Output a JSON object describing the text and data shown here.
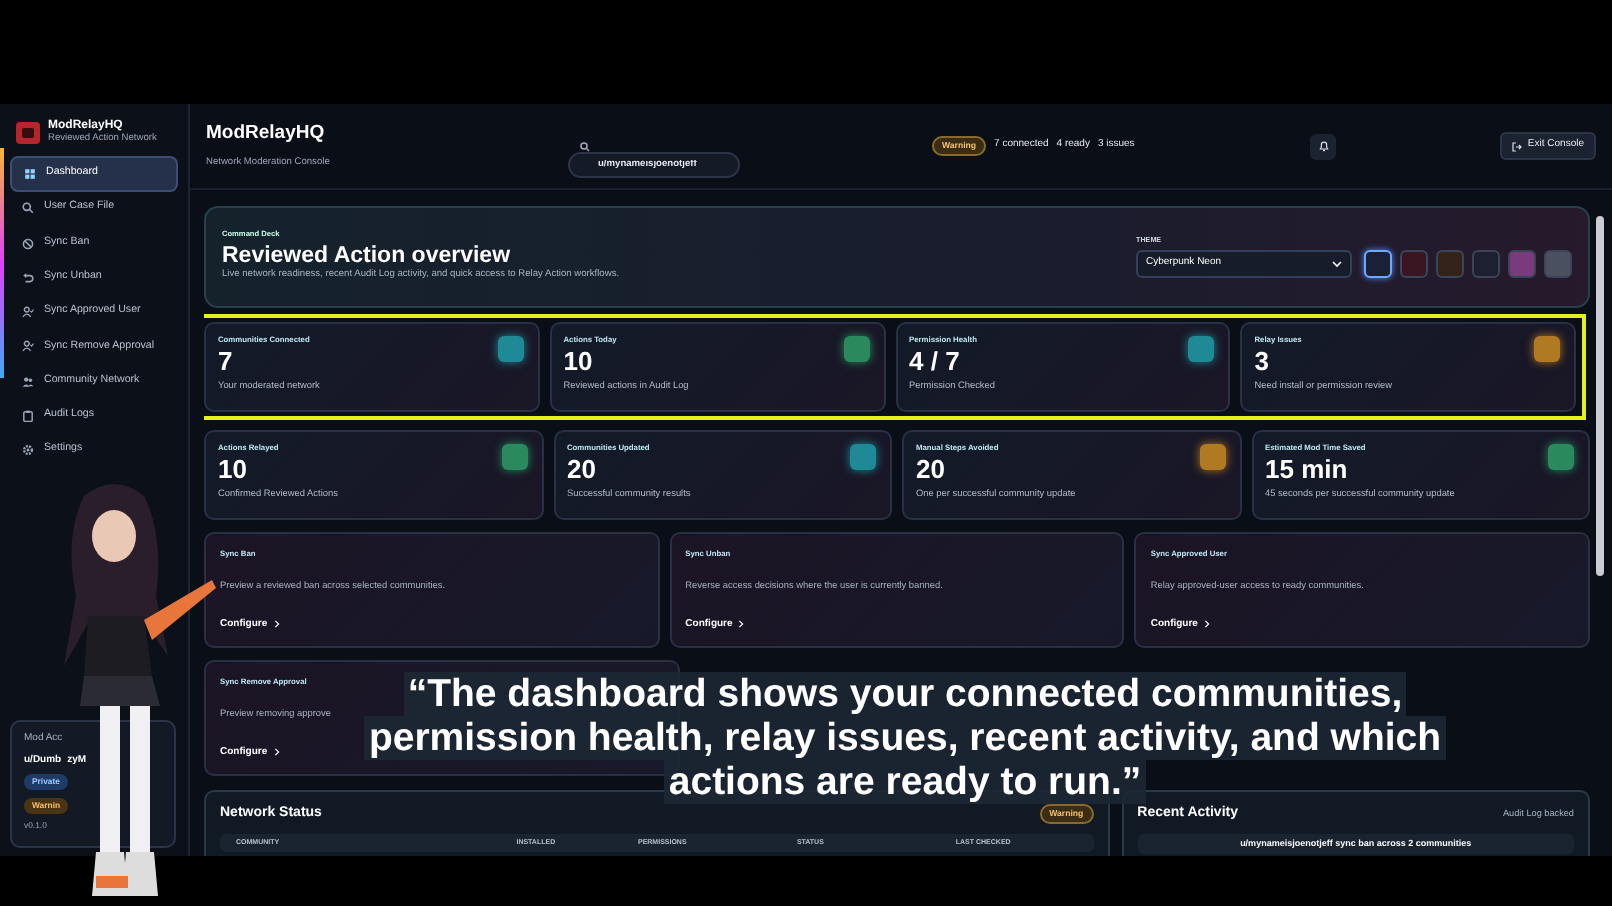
{
  "brand": {
    "name": "ModRelayHQ",
    "tagline": "Reviewed Action Network"
  },
  "sidebar": {
    "items": [
      {
        "label": "Dashboard",
        "kind": "grid",
        "selected": true
      },
      {
        "label": "User Case File",
        "kind": "search",
        "selected": false
      },
      {
        "label": "Sync Ban",
        "kind": "ban",
        "selected": false
      },
      {
        "label": "Sync Unban",
        "kind": "undo",
        "selected": false
      },
      {
        "label": "Sync Approved User",
        "kind": "user",
        "selected": false
      },
      {
        "label": "Sync Remove Approval",
        "kind": "user",
        "selected": false
      },
      {
        "label": "Community Network",
        "kind": "people",
        "selected": false
      },
      {
        "label": "Audit Logs",
        "kind": "clipboard",
        "selected": false
      },
      {
        "label": "Settings",
        "kind": "gear",
        "selected": false
      }
    ]
  },
  "account": {
    "label": "Mod Acc",
    "user": "u/Dumb",
    "user_tail": "zyM",
    "badges": [
      "Private",
      "Warnin"
    ],
    "version": "v0.1.0"
  },
  "header": {
    "title": "ModRelayHQ",
    "subtitle": "Network Moderation Console",
    "search": {
      "value": "u/mynameisjoenotjeff"
    },
    "status_badge": "Warning",
    "status_items": [
      "7 connected",
      "4 ready",
      "3 issues"
    ],
    "exit_button": "Exit Console"
  },
  "hero": {
    "eyebrow": "Command Deck",
    "title": "Reviewed Action overview",
    "description": "Live network readiness, recent Audit Log activity, and quick access to Relay Action workflows.",
    "theme_label": "THEME",
    "theme_value": "Cyberpunk Neon",
    "swatches": [
      {
        "color": "#1a2036",
        "selected": true
      },
      {
        "color": "#3a1622",
        "selected": false
      },
      {
        "color": "#33231a",
        "selected": false
      },
      {
        "color": "#1c2030",
        "selected": false
      },
      {
        "color": "#7a3a7e",
        "selected": false
      },
      {
        "color": "#4b5060",
        "selected": false
      }
    ]
  },
  "stat_rows": [
    {
      "highlighted": true,
      "cards": [
        {
          "label": "Communities Connected",
          "value": "7",
          "note": "Your moderated network",
          "color": "#1f8a96"
        },
        {
          "label": "Actions Today",
          "value": "10",
          "note": "Reviewed actions in Audit Log",
          "color": "#2a8a5e"
        },
        {
          "label": "Permission Health",
          "value": "4 / 7",
          "note": "Permission Checked",
          "color": "#1f8a96"
        },
        {
          "label": "Relay Issues",
          "value": "3",
          "note": "Need install or permission review",
          "color": "#b07a22"
        }
      ]
    },
    {
      "highlighted": false,
      "cards": [
        {
          "label": "Actions Relayed",
          "value": "10",
          "note": "Confirmed Reviewed Actions",
          "color": "#2a8a5e"
        },
        {
          "label": "Communities Updated",
          "value": "20",
          "note": "Successful community results",
          "color": "#1f8a96"
        },
        {
          "label": "Manual Steps Avoided",
          "value": "20",
          "note": "One per successful community update",
          "color": "#b07a22"
        },
        {
          "label": "Estimated Mod Time Saved",
          "value": "15 min",
          "note": "45 seconds per successful community update",
          "color": "#2a8a5e"
        }
      ]
    }
  ],
  "actions": [
    {
      "title": "Sync Ban",
      "description": "Preview a reviewed ban across selected communities.",
      "link": "Configure"
    },
    {
      "title": "Sync Unban",
      "description": "Reverse access decisions where the user is currently banned.",
      "link": "Configure"
    },
    {
      "title": "Sync Approved User",
      "description": "Relay approved-user access to ready communities.",
      "link": "Configure"
    },
    {
      "title": "Sync Remove Approval",
      "description": "Preview removing approve",
      "link": "Configure"
    }
  ],
  "network_status": {
    "title": "Network Status",
    "badge": "Warning",
    "columns": [
      "COMMUNITY",
      "INSTALLED",
      "PERMISSIONS",
      "STATUS",
      "LAST CHECKED"
    ]
  },
  "recent_activity": {
    "title": "Recent Activity",
    "note": "Audit Log backed",
    "items": [
      "u/mynameisjoenotjeff sync ban across 2 communities"
    ]
  },
  "caption": {
    "lines": [
      "“The dashboard shows your connected communities,",
      "permission health, relay issues, recent activity, and which",
      "actions are ready to run.”"
    ]
  }
}
